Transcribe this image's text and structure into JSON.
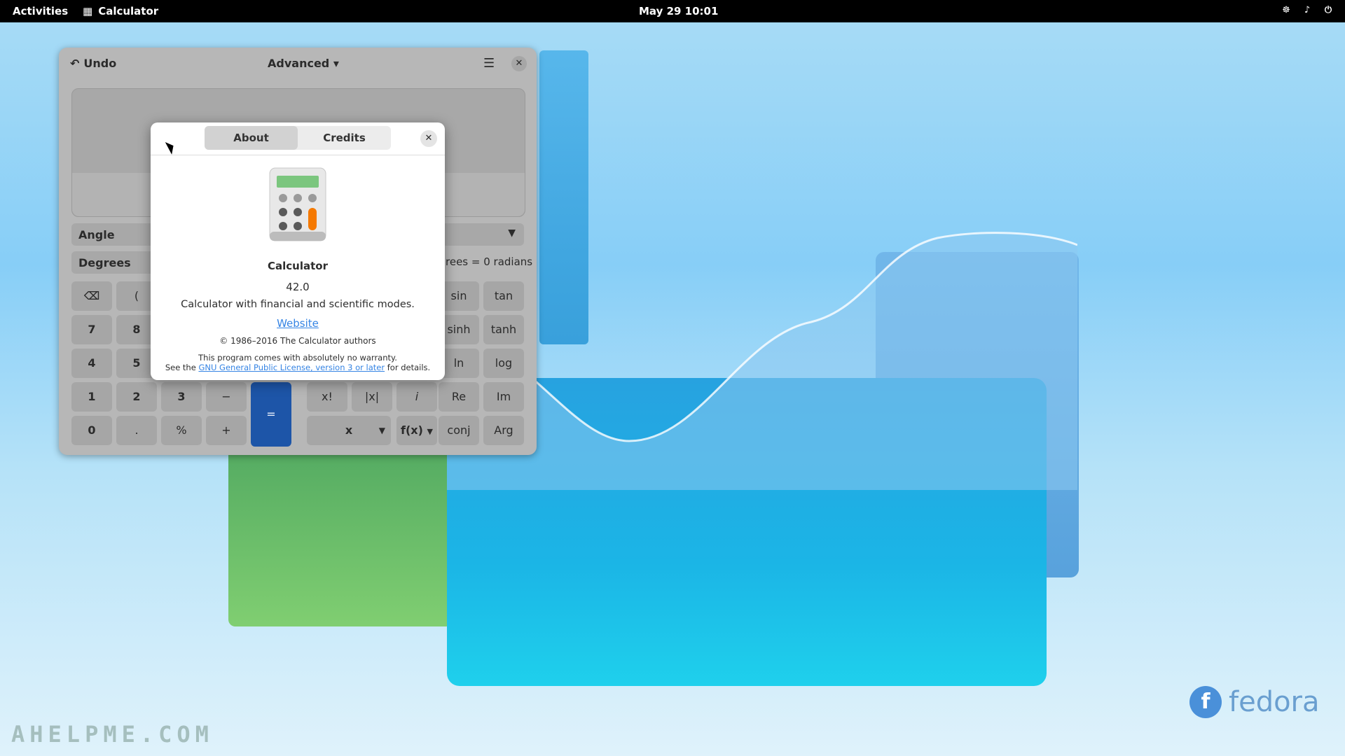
{
  "topbar": {
    "activities": "Activities",
    "app_name": "Calculator",
    "clock": "May 29  10:01"
  },
  "calculator": {
    "undo_label": "Undo",
    "mode_label": "Advanced",
    "angle_label": "Angle",
    "degrees_label": "Degrees",
    "conversion": "rees  =  0 radians",
    "keys": {
      "paren_open": "(",
      "sin": "sin",
      "tan": "tan",
      "k7": "7",
      "k8": "8",
      "sinh": "sinh",
      "tanh": "tanh",
      "k4": "4",
      "k5": "5",
      "ln": "ln",
      "log": "log",
      "k1": "1",
      "k2": "2",
      "k3": "3",
      "minus": "−",
      "equals": "=",
      "fact": "x!",
      "abs": "|x|",
      "imag": "i",
      "re": "Re",
      "im": "Im",
      "k0": "0",
      "dot": ".",
      "percent": "%",
      "plus": "+",
      "x_var": "x",
      "fx": "f(x)",
      "conj": "conj",
      "arg": "Arg"
    }
  },
  "about_dialog": {
    "tab_about": "About",
    "tab_credits": "Credits",
    "app_name": "Calculator",
    "version": "42.0",
    "description": "Calculator with financial and scientific modes.",
    "website": "Website",
    "copyright": "© 1986–2016 The Calculator authors",
    "warranty_line1": "This program comes with absolutely no warranty.",
    "warranty_pre": "See the ",
    "license_link": "GNU General Public License, version 3 or later",
    "warranty_post": " for details."
  },
  "desktop": {
    "distro_logo_text": "fedora",
    "watermark": "AHELPME.COM"
  },
  "colors": {
    "accent": "#3584e4",
    "equals_key": "#1d55a8",
    "calc_green": "#7bc67e",
    "calc_orange": "#f57900"
  }
}
